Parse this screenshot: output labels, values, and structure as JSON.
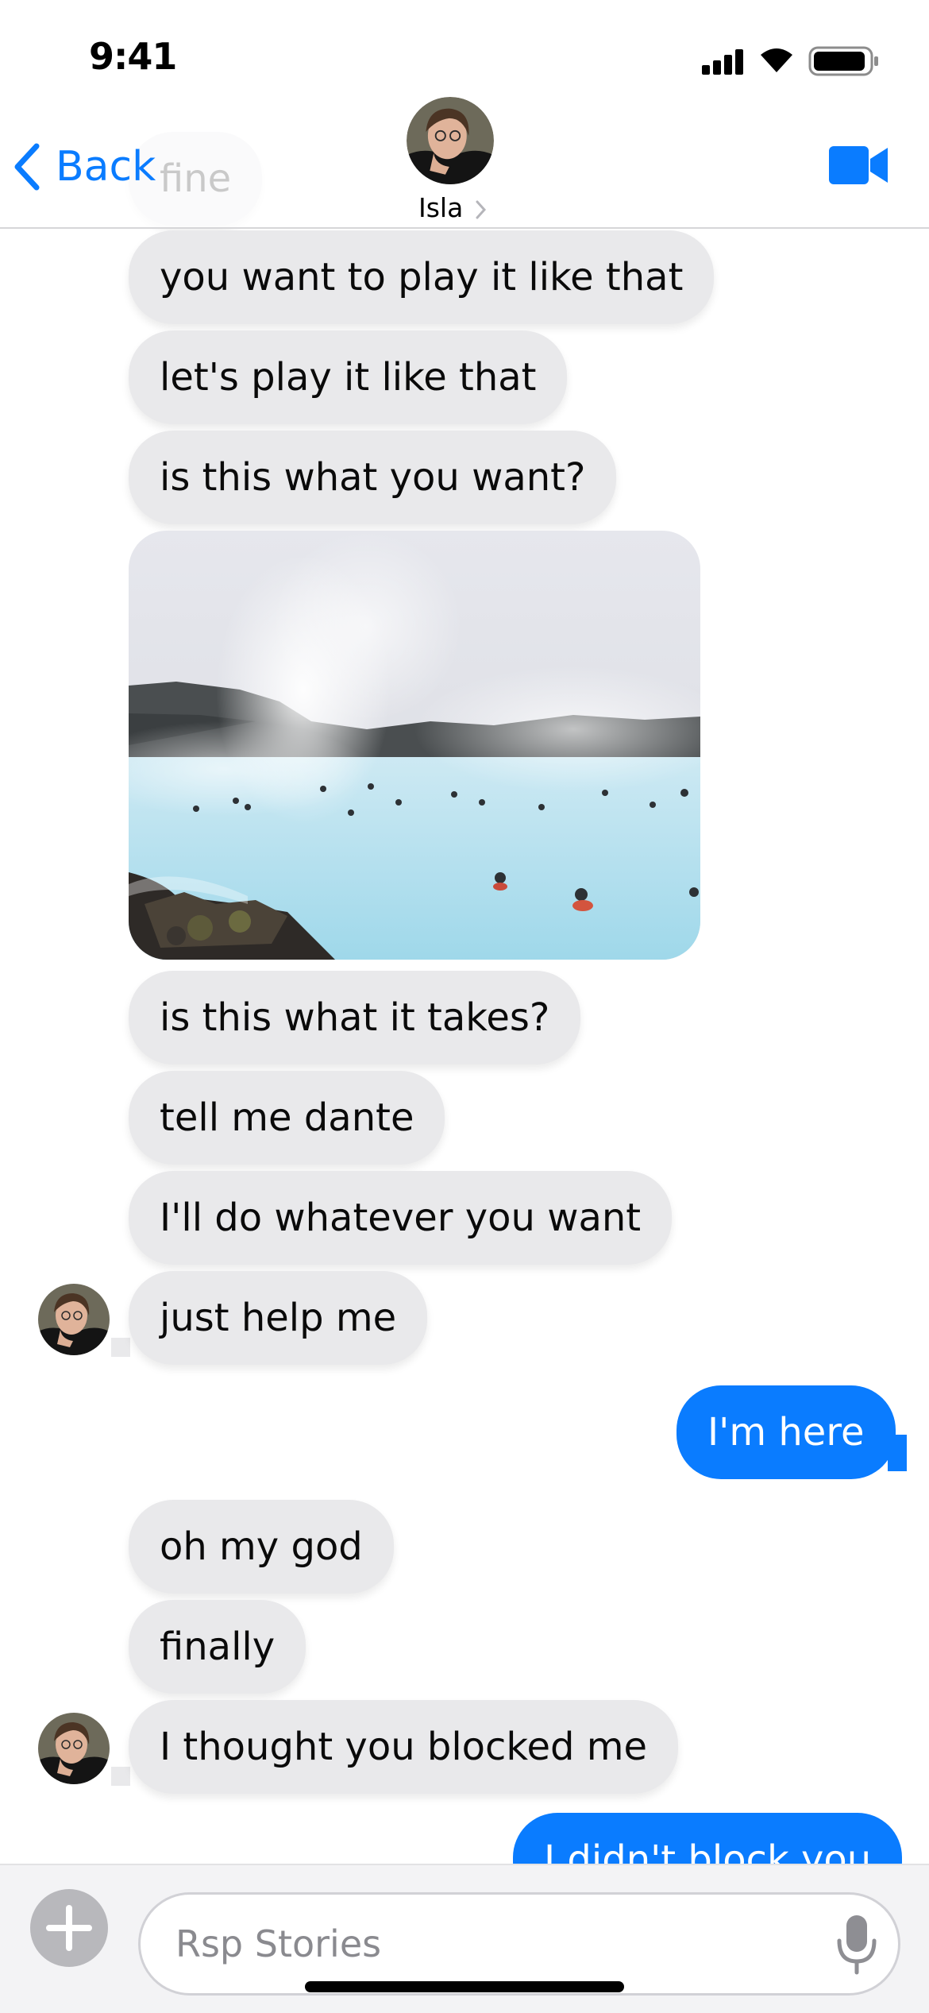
{
  "status_bar": {
    "time": "9:41"
  },
  "nav": {
    "back_label": "Back",
    "contact_name": "Isla",
    "icons": [
      "back-chevron-icon",
      "video-camera-icon",
      "chevron-right-icon"
    ]
  },
  "messages": {
    "m0": "fine",
    "m1": "you want to play it like that",
    "m2": "let's play it like that",
    "m3": "is this what you want?",
    "m5": "is this what it takes?",
    "m6": "tell me dante",
    "m7": "I'll do whatever you want",
    "m8": "just help me",
    "m9": "I'm here",
    "m10": "oh my god",
    "m11": "finally",
    "m12": "I thought you blocked me",
    "m13": "I didn't block you"
  },
  "composer": {
    "placeholder": "Rsp Stories",
    "icons": [
      "plus-icon",
      "microphone-icon"
    ]
  },
  "colors": {
    "accent": "#0a7cff",
    "incoming_bubble": "#e9e9eb",
    "outgoing_bubble": "#0a7cff"
  }
}
